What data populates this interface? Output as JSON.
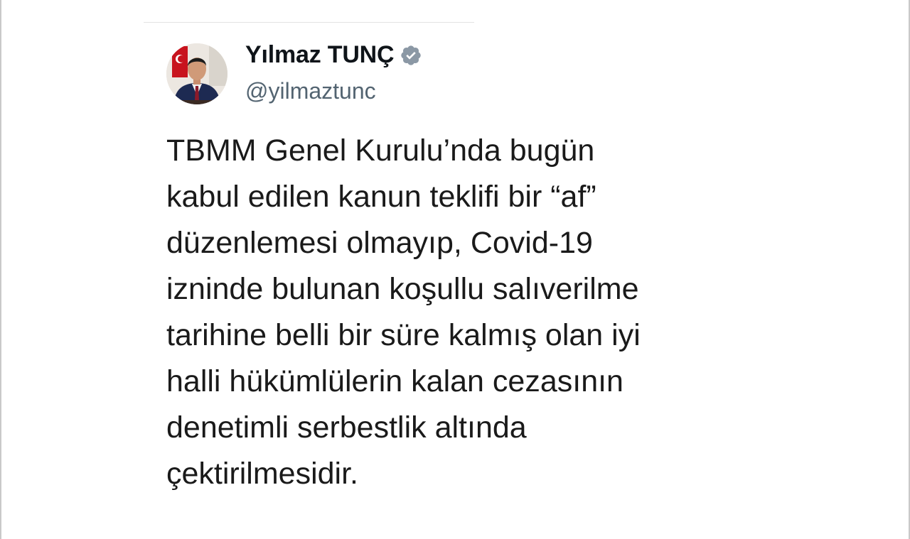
{
  "tweet": {
    "display_name": "Yılmaz TUNÇ",
    "handle": "@yilmaztunc",
    "text": "TBMM Genel Kurulu’nda bugün\nkabul edilen kanun teklifi bir “af”\ndüzenlemesi olmayıp, Covid-19\nizninde bulunan koşullu salıverilme\ntarihine belli bir süre kalmış olan iyi\nhalli hükümlülerin kalan cezasının\ndenetimli serbestlik altında\nçektirilmesidir."
  },
  "icons": {
    "verified": "verified-badge-icon",
    "avatar": "profile-photo"
  },
  "colors": {
    "name": "#0f1419",
    "handle": "#536471",
    "text": "#1a1a1a",
    "badge": "#8b98a5"
  }
}
